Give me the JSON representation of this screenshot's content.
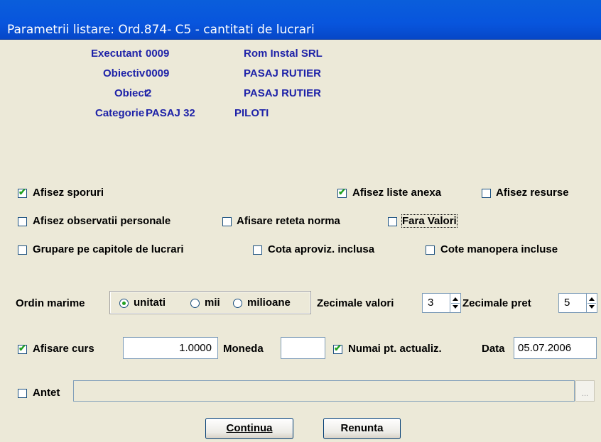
{
  "window": {
    "title": "Parametrii listare: Ord.874- C5 - cantitati de lucrari"
  },
  "info": {
    "executant_label": "Executant",
    "executant_code": "0009",
    "executant_name": "Rom Instal SRL",
    "obiectiv_label": "Obiectiv",
    "obiectiv_code": "0009",
    "obiectiv_name": "PASAJ RUTIER",
    "obiect_label": "Obiect",
    "obiect_code": "2",
    "obiect_name": "PASAJ RUTIER",
    "categorie_label": "Categorie",
    "categorie_code": "PASAJ 32",
    "categorie_name": "PILOTI"
  },
  "options": {
    "afisez_sporuri": {
      "label": "Afisez sporuri",
      "checked": true
    },
    "afisez_liste_anexa": {
      "label": "Afisez liste anexa",
      "checked": true
    },
    "afisez_resurse": {
      "label": "Afisez resurse",
      "checked": false
    },
    "afisez_observatii": {
      "label": "Afisez observatii personale",
      "checked": false
    },
    "afisare_reteta": {
      "label": "Afisare reteta norma",
      "checked": false
    },
    "fara_valori": {
      "label": "Fara Valori",
      "checked": false
    },
    "grupare_capitole": {
      "label": "Grupare pe capitole de lucrari",
      "checked": false
    },
    "cota_aproviz": {
      "label": "Cota aproviz. inclusa",
      "checked": false
    },
    "cote_manopera": {
      "label": "Cote manopera incluse",
      "checked": false
    }
  },
  "ordin": {
    "label": "Ordin marime",
    "options": [
      "unitati",
      "mii",
      "milioane"
    ],
    "selected": "unitati"
  },
  "zecimale_valori": {
    "label": "Zecimale valori",
    "value": "3"
  },
  "zecimale_pret": {
    "label": "Zecimale pret",
    "value": "5"
  },
  "curs": {
    "label": "Afisare curs",
    "checked": true,
    "value": "1.0000"
  },
  "moneda": {
    "label": "Moneda",
    "value": ""
  },
  "numai_actualiz": {
    "label": "Numai pt. actualiz.",
    "checked": true
  },
  "data": {
    "label": "Data",
    "value": "05.07.2006"
  },
  "antet": {
    "label": "Antet",
    "checked": false,
    "value": "",
    "browse": "..."
  },
  "buttons": {
    "continua": "Continua",
    "renunta": "Renunta"
  },
  "colors": {
    "title_bar": "#0855DD",
    "info_text": "#1E22A8",
    "dialog_bg": "#ECE9D8",
    "check_mark": "#21A121"
  }
}
